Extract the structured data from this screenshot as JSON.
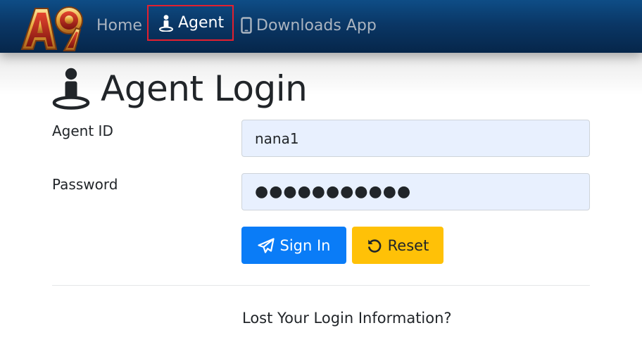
{
  "colors": {
    "navbar": "#0a3766",
    "nav_active_border": "#e3202f",
    "signin_button": "#0a7cf7",
    "reset_button": "#ffc107",
    "input_background": "#e8f0fe"
  },
  "navbar": {
    "logo_text": "A9",
    "items": [
      {
        "label": "Home",
        "icon": "",
        "active": false
      },
      {
        "label": "Agent",
        "icon": "person-pin-icon",
        "active": true
      },
      {
        "label": "Downloads App",
        "icon": "mobile-phone-icon",
        "active": false
      }
    ]
  },
  "page": {
    "title": "Agent Login",
    "title_icon": "person-pin-icon"
  },
  "form": {
    "agent_id": {
      "label": "Agent ID",
      "value": "nana1"
    },
    "password": {
      "label": "Password",
      "value": "●●●●●●●●●●●"
    },
    "signin": {
      "label": "Sign In",
      "icon": "paper-plane-icon"
    },
    "reset": {
      "label": "Reset",
      "icon": "undo-icon"
    }
  },
  "footer": {
    "lost_link": "Lost Your Login Information?"
  }
}
